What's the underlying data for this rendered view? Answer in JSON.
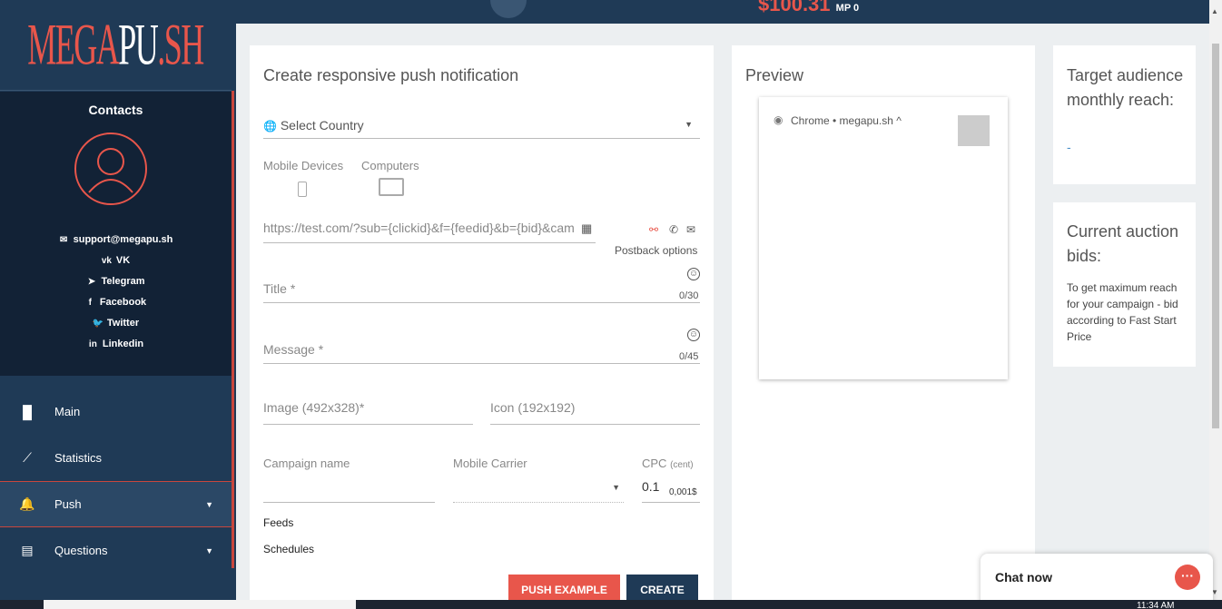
{
  "sidebar": {
    "logo": {
      "part1": "MEGA",
      "part2": "PU",
      "part3": ".SH"
    },
    "contacts_title": "Contacts",
    "contacts": [
      {
        "icon": "envelope-icon",
        "glyph": "✉",
        "label": "support@megapu.sh"
      },
      {
        "icon": "vk-icon",
        "glyph": "vk",
        "label": "VK"
      },
      {
        "icon": "telegram-icon",
        "glyph": "➤",
        "label": "Telegram"
      },
      {
        "icon": "facebook-icon",
        "glyph": "f",
        "label": "Facebook"
      },
      {
        "icon": "twitter-icon",
        "glyph": "🐦",
        "label": "Twitter"
      },
      {
        "icon": "linkedin-icon",
        "glyph": "in",
        "label": "Linkedin"
      }
    ],
    "nav": [
      {
        "icon": "bar-chart-icon",
        "label": "Main",
        "active": false
      },
      {
        "icon": "trend-line-icon",
        "label": "Statistics",
        "active": false
      },
      {
        "icon": "bell-icon",
        "label": "Push",
        "active": true
      },
      {
        "icon": "chat-icon",
        "label": "Questions",
        "active": false
      }
    ]
  },
  "header": {
    "balance": "$100.31",
    "balance_suffix": "MP 0"
  },
  "form": {
    "title": "Create responsive push notification",
    "country_placeholder": "Select Country",
    "device_mobile": "Mobile Devices",
    "device_computers": "Computers",
    "url_value": "https://test.com/?sub={clickid}&f={feedid}&b={bid}&cam",
    "postback_label": "Postback options",
    "title_placeholder": "Title *",
    "title_counter": "0/30",
    "message_placeholder": "Message *",
    "message_counter": "0/45",
    "image_placeholder": "Image (492x328)*",
    "icon_placeholder": "Icon (192x192)",
    "campaign_label": "Campaign name",
    "carrier_label": "Mobile Carrier",
    "cpc_label": "CPC",
    "cpc_unit": "(cent)",
    "cpc_value": "0.1",
    "cpc_dollar": "0,001$",
    "feeds_label": "Feeds",
    "schedules_label": "Schedules",
    "push_example_btn": "PUSH EXAMPLE",
    "create_btn": "CREATE"
  },
  "preview": {
    "title": "Preview",
    "browser_line": "Chrome • megapu.sh ^"
  },
  "target": {
    "title": "Target audience monthly reach:",
    "value": "-"
  },
  "auction": {
    "title": "Current auction bids:",
    "text": "To get maximum reach for your campaign - bid according to Fast Start Price"
  },
  "chat": {
    "label": "Chat now"
  },
  "taskbar": {
    "clock": "11:34 AM"
  },
  "colors": {
    "sidebar": "#1f3a56",
    "accent": "#e8564b",
    "dark": "#122236"
  }
}
